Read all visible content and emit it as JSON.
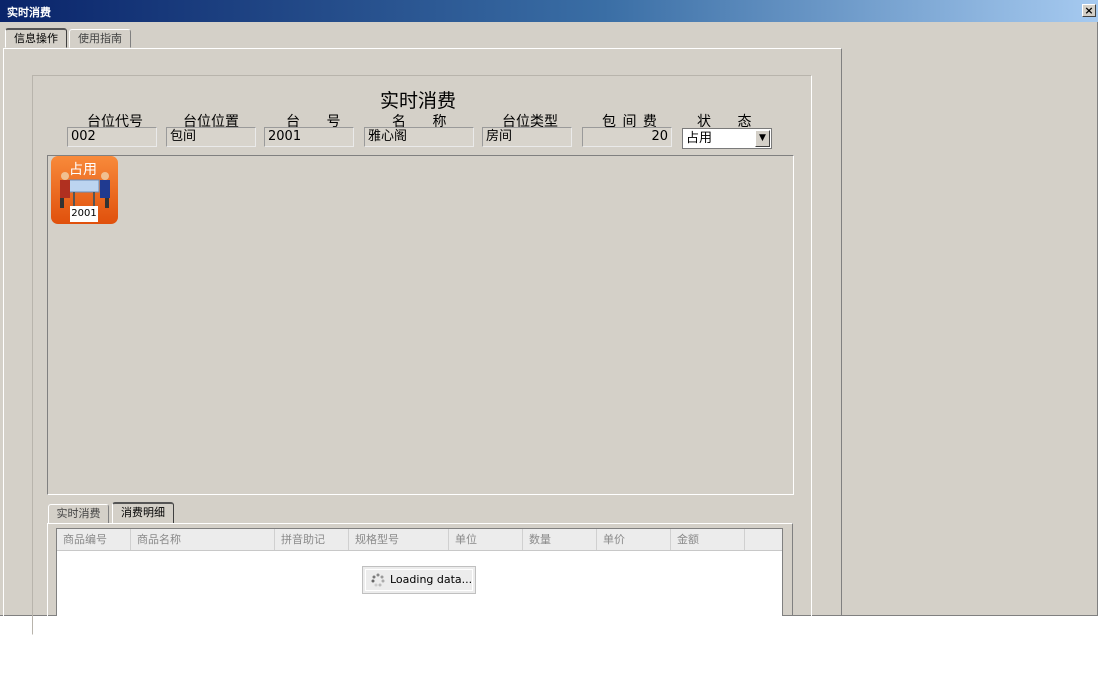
{
  "window": {
    "title": "实时消费",
    "close_label": "×"
  },
  "top_tabs": [
    {
      "label": "信息操作"
    },
    {
      "label": "使用指南"
    }
  ],
  "form": {
    "heading": "实时消费",
    "labels": {
      "code": "台位代号",
      "position": "台位位置",
      "number": "台 号",
      "name": "名 称",
      "type": "台位类型",
      "room_fee": "包 间 费",
      "status": "状 态"
    },
    "values": {
      "code": "002",
      "position": "包间",
      "number": "2001",
      "name": "雅心阁",
      "type": "房间",
      "room_fee": "20",
      "status": "占用"
    }
  },
  "seat": {
    "status": "占用",
    "number": "2001",
    "icon": "two-people-at-table-icon"
  },
  "bottom_tabs": [
    {
      "label": "实时消费"
    },
    {
      "label": "消费明细"
    }
  ],
  "grid": {
    "columns": [
      "商品编号",
      "商品名称",
      "拼音助记",
      "规格型号",
      "单位",
      "数量",
      "单价",
      "金额"
    ],
    "loading_text": "Loading data..."
  },
  "colors": {
    "titlebar_start": "#0a246a",
    "titlebar_end": "#a6caf0",
    "seat_orange": "#e0500c"
  }
}
